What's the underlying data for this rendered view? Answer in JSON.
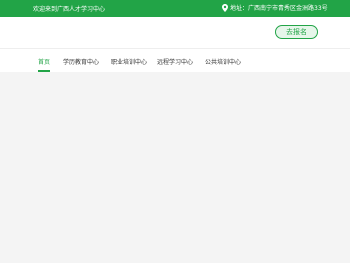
{
  "topbar": {
    "welcome": "欢迎来到广西人才学习中心",
    "address": "地址：广西南宁市青秀区金洲路33号",
    "bg_color": "#22a447"
  },
  "header": {
    "signup_label": "去报名"
  },
  "nav": {
    "items": [
      {
        "label": "首页",
        "active": true
      },
      {
        "label": "学历教育中心",
        "active": false
      },
      {
        "label": "职业培训中心",
        "active": false
      },
      {
        "label": "远程学习中心",
        "active": false
      },
      {
        "label": "公共培训中心",
        "active": false
      }
    ],
    "accent": "#22a447"
  }
}
